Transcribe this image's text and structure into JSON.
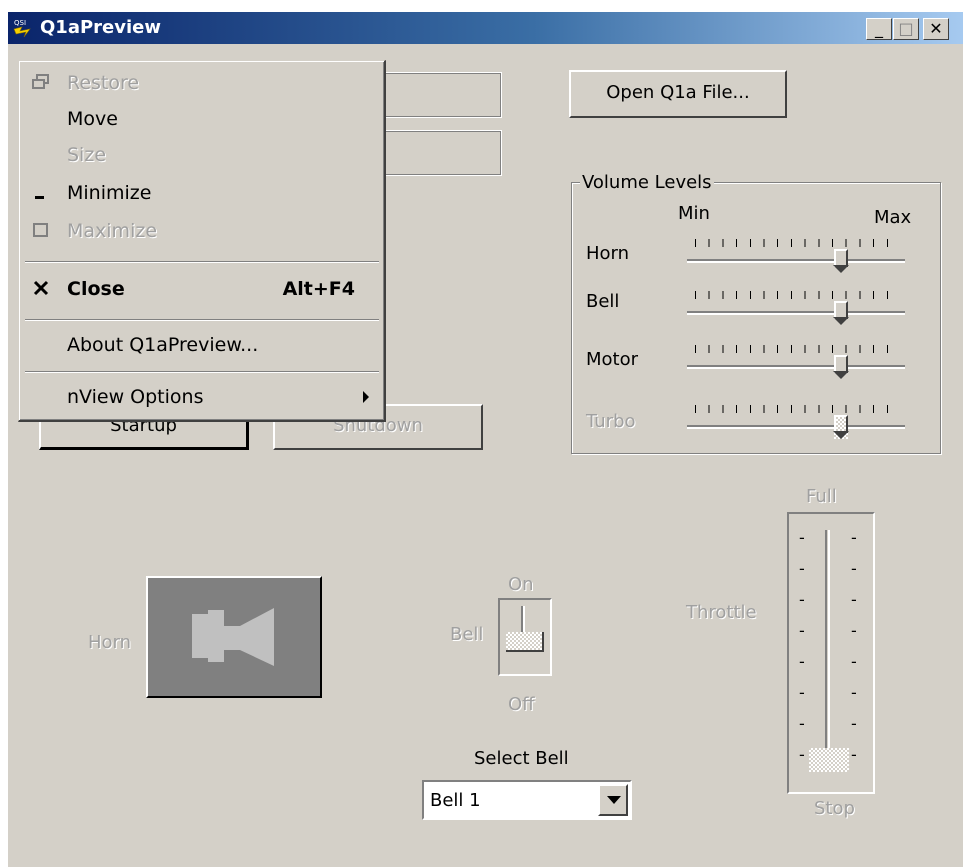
{
  "window": {
    "title": "Q1aPreview",
    "controls": {
      "minimize": "_",
      "maximize": "□",
      "close": "✕"
    }
  },
  "buttons": {
    "open_file": "Open Q1a File...",
    "startup": "Startup",
    "shutdown": "Shutdown"
  },
  "volume": {
    "title": "Volume Levels",
    "min_label": "Min",
    "max_label": "Max",
    "sliders": [
      {
        "label": "Horn",
        "level": 0.72,
        "enabled": true
      },
      {
        "label": "Bell",
        "level": 0.72,
        "enabled": true
      },
      {
        "label": "Motor",
        "level": 0.72,
        "enabled": true
      },
      {
        "label": "Turbo",
        "level": 0.72,
        "enabled": false
      }
    ]
  },
  "horn": {
    "label": "Horn"
  },
  "bell_switch": {
    "on_label": "On",
    "label": "Bell",
    "off_label": "Off"
  },
  "select_bell": {
    "label": "Select Bell",
    "value": "Bell 1"
  },
  "throttle": {
    "label": "Throttle",
    "top_label": "Full",
    "bottom_label": "Stop",
    "level": 0.0,
    "tick_mark": "-"
  },
  "system_menu": {
    "items": [
      {
        "label": "Restore",
        "icon": "restore-icon",
        "enabled": false
      },
      {
        "label": "Move",
        "enabled": true
      },
      {
        "label": "Size",
        "enabled": false
      },
      {
        "label": "Minimize",
        "icon": "minimize-icon",
        "enabled": true
      },
      {
        "label": "Maximize",
        "icon": "maximize-icon",
        "enabled": false
      },
      {
        "label": "Close",
        "icon": "close-icon",
        "accelerator": "Alt+F4",
        "enabled": true,
        "bold": true
      },
      {
        "label": "About Q1aPreview...",
        "enabled": true
      },
      {
        "label": "nView Options",
        "submenu": true,
        "enabled": true
      }
    ]
  }
}
